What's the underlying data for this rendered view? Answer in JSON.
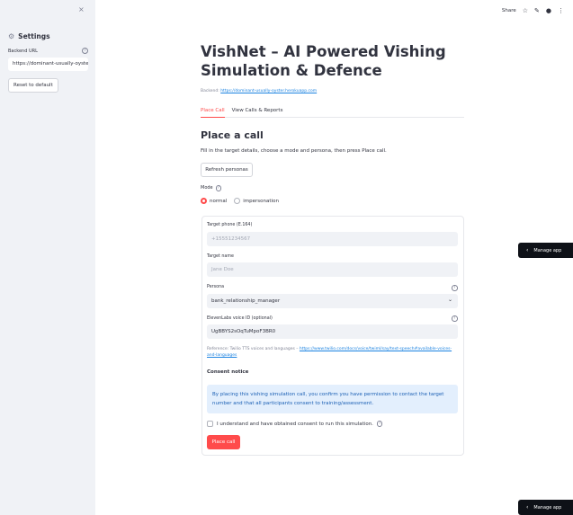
{
  "sidebar": {
    "close_glyph": "×",
    "title": "Settings",
    "backend_label": "Backend URL",
    "backend_value": "https://dominant-usually-oyster.herokuapp.com",
    "reset_label": "Reset to default"
  },
  "toolbar": {
    "share": "Share"
  },
  "main": {
    "title": "VishNet – AI Powered Vishing Simulation & Defence",
    "backend_prefix": "Backend: ",
    "backend_link": "https://dominant-usually-oyster.herokuapp.com",
    "tabs": [
      {
        "label": "Place Call",
        "active": true
      },
      {
        "label": "View Calls & Reports",
        "active": false
      }
    ],
    "heading": "Place a call",
    "description": "Fill in the target details, choose a mode and persona, then press Place call.",
    "refresh_label": "Refresh personas",
    "mode_label": "Mode",
    "modes": [
      {
        "label": "normal",
        "selected": true
      },
      {
        "label": "impersonation",
        "selected": false
      }
    ]
  },
  "form": {
    "phone_label": "Target phone (E.164)",
    "phone_placeholder": "+15551234567",
    "name_label": "Target name",
    "name_placeholder": "Jane Doe",
    "persona_label": "Persona",
    "persona_value": "bank_relationship_manager",
    "voice_label": "ElevenLabs voice ID (optional)",
    "voice_value": "UgBBYS2sOqTuMpoF3BR0",
    "reference_prefix": "Reference: Twilio TTS voices and languages – ",
    "reference_link": "https://www.twilio.com/docs/voice/twiml/say/text-speech#available-voices-and-languages",
    "consent_heading": "Consent notice",
    "consent_text": "By placing this vishing simulation call, you confirm you have permission to contact the target number and that all participants consent to training/assessment.",
    "checkbox_label": "I understand and have obtained consent to run this simulation.",
    "place_label": "Place call"
  },
  "manage_app": {
    "label": "Manage app"
  },
  "colors": {
    "accent": "#ff4b4b",
    "sidebar_bg": "#f0f2f6",
    "info_bg": "#e3effd",
    "manage_bg": "#0e1117"
  }
}
